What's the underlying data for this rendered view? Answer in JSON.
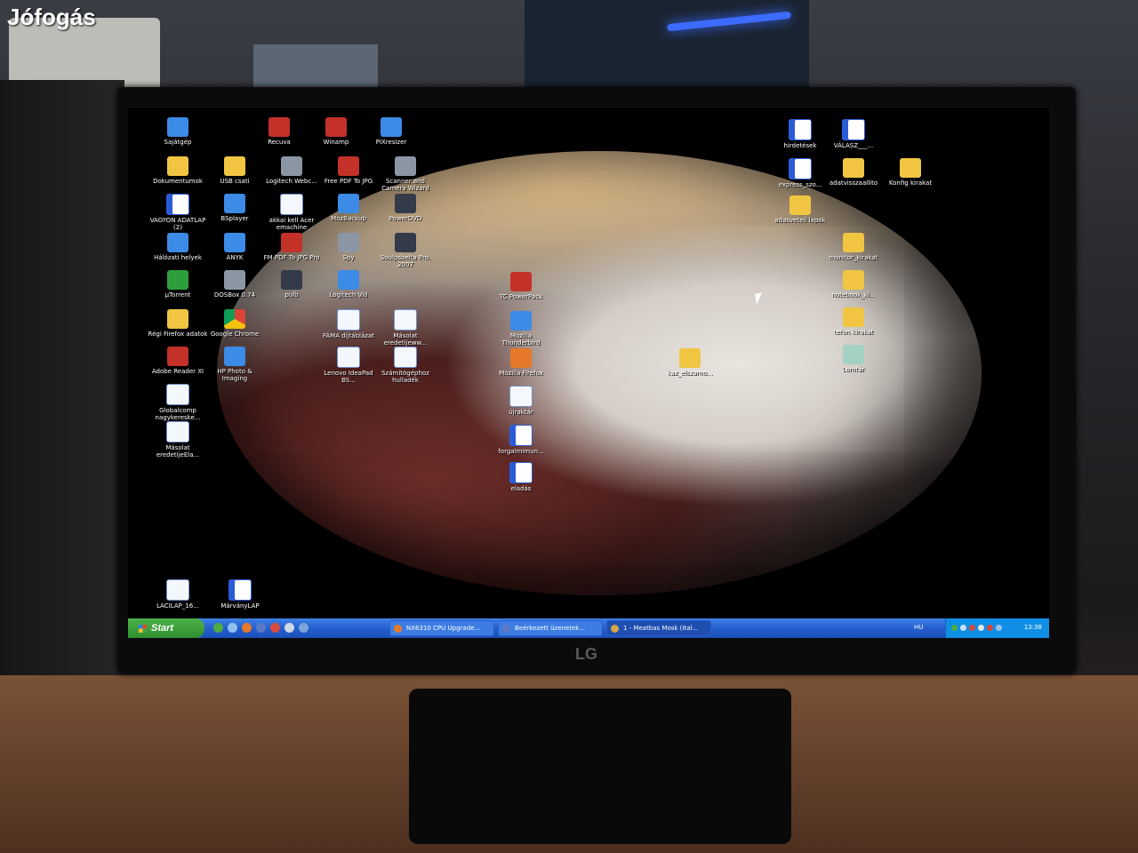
{
  "watermark": "Jófogás",
  "monitor": {
    "brand_logo": "LG"
  },
  "desktop_icons_left": [
    {
      "label": "Sajátgép",
      "icon": "computer-icon"
    },
    {
      "label": "Recuva",
      "icon": "recuva-icon"
    },
    {
      "label": "Winamp",
      "icon": "winamp-icon"
    },
    {
      "label": "PIXresizer",
      "icon": "pixresizer-icon"
    },
    {
      "label": "Dokumentumok",
      "icon": "documents-folder-icon"
    },
    {
      "label": "USB csati",
      "icon": "folder-icon"
    },
    {
      "label": "Logitech Webc...",
      "icon": "webcam-icon"
    },
    {
      "label": "Free PDF To JPG",
      "icon": "pdf-to-jpg-icon"
    },
    {
      "label": "Scanner and Camera Wizard",
      "icon": "scanner-icon"
    },
    {
      "label": "VAGYON ADATLAP (2)",
      "icon": "word-document-icon"
    },
    {
      "label": "BSplayer",
      "icon": "bsplayer-icon"
    },
    {
      "label": "akkai kell Acer emachine",
      "icon": "document-icon"
    },
    {
      "label": "MozBackup",
      "icon": "mozbackup-icon"
    },
    {
      "label": "PowerDVD",
      "icon": "powerdvd-icon"
    },
    {
      "label": "Hálózati helyek",
      "icon": "network-icon"
    },
    {
      "label": "ÁNYK",
      "icon": "anyk-icon"
    },
    {
      "label": "FM PDF To JPG Pro",
      "icon": "pdf-converter-icon"
    },
    {
      "label": "Spy",
      "icon": "eye-icon"
    },
    {
      "label": "Soulpsbelta Pro. 2007",
      "icon": "app-icon"
    },
    {
      "label": "µTorrent",
      "icon": "utorrent-icon"
    },
    {
      "label": "DOSBox 0.74",
      "icon": "dosbox-icon"
    },
    {
      "label": "pulb",
      "icon": "app-icon"
    },
    {
      "label": "Logitech Vid",
      "icon": "logitech-vid-icon"
    },
    {
      "label": "Régi Firefox adatok",
      "icon": "folder-icon"
    },
    {
      "label": "Google Chrome",
      "icon": "chrome-icon"
    },
    {
      "label": "FÁMA díjtáblázat",
      "icon": "document-icon"
    },
    {
      "label": "Másolat eredetijeww...",
      "icon": "spreadsheet-icon"
    },
    {
      "label": "Adobe Reader XI",
      "icon": "adobe-reader-icon"
    },
    {
      "label": "HP Photo & Imaging",
      "icon": "hp-photo-icon"
    },
    {
      "label": "Lenovo IdeaPad BS...",
      "icon": "document-icon"
    },
    {
      "label": "Számítógéphoz hulladék",
      "icon": "spreadsheet-icon"
    },
    {
      "label": "Globalcomp nagykereske...",
      "icon": "document-icon"
    },
    {
      "label": "Másolat eredetijeEla...",
      "icon": "document-icon"
    },
    {
      "label": "LACILAP_16...",
      "icon": "document-icon"
    },
    {
      "label": "MárványLAP",
      "icon": "word-document-icon"
    }
  ],
  "desktop_icons_center": [
    {
      "label": "TC PowerPack",
      "icon": "tcpowerpack-icon"
    },
    {
      "label": "Mozilla Thunderbird",
      "icon": "thunderbird-icon"
    },
    {
      "label": "Mozilla Firefox",
      "icon": "firefox-icon"
    },
    {
      "label": "újraktár",
      "icon": "document-icon"
    },
    {
      "label": "forgalmimun...",
      "icon": "word-document-icon"
    },
    {
      "label": "eladás",
      "icon": "word-document-icon"
    },
    {
      "label": "kaz_elszamo...",
      "icon": "folder-icon"
    }
  ],
  "desktop_icons_right": [
    {
      "label": "hirdetések",
      "icon": "word-document-icon"
    },
    {
      "label": "VÁLASZ___...",
      "icon": "word-document-icon"
    },
    {
      "label": "express_szo...",
      "icon": "word-document-icon"
    },
    {
      "label": "adatvisszaallito",
      "icon": "folder-icon"
    },
    {
      "label": "Konfig kirakat",
      "icon": "folder-icon"
    },
    {
      "label": "adasveteli lapok",
      "icon": "folder-icon"
    },
    {
      "label": "monitor_kirakat",
      "icon": "folder-icon"
    },
    {
      "label": "notebook_ki...",
      "icon": "folder-icon"
    },
    {
      "label": "tefon kirakat",
      "icon": "folder-icon"
    },
    {
      "label": "Lomtár",
      "icon": "recycle-bin-icon"
    }
  ],
  "taskbar": {
    "start_label": "Start",
    "tasks": [
      {
        "label": "NX6310 CPU Upgrade...",
        "icon": "firefox-icon"
      },
      {
        "label": "Beérkezett üzenetek...",
        "icon": "thunderbird-icon"
      },
      {
        "label": "1 - Meatbas Mosk (Ital...",
        "icon": "app-icon"
      }
    ],
    "language": "HU",
    "clock": "13:38"
  }
}
